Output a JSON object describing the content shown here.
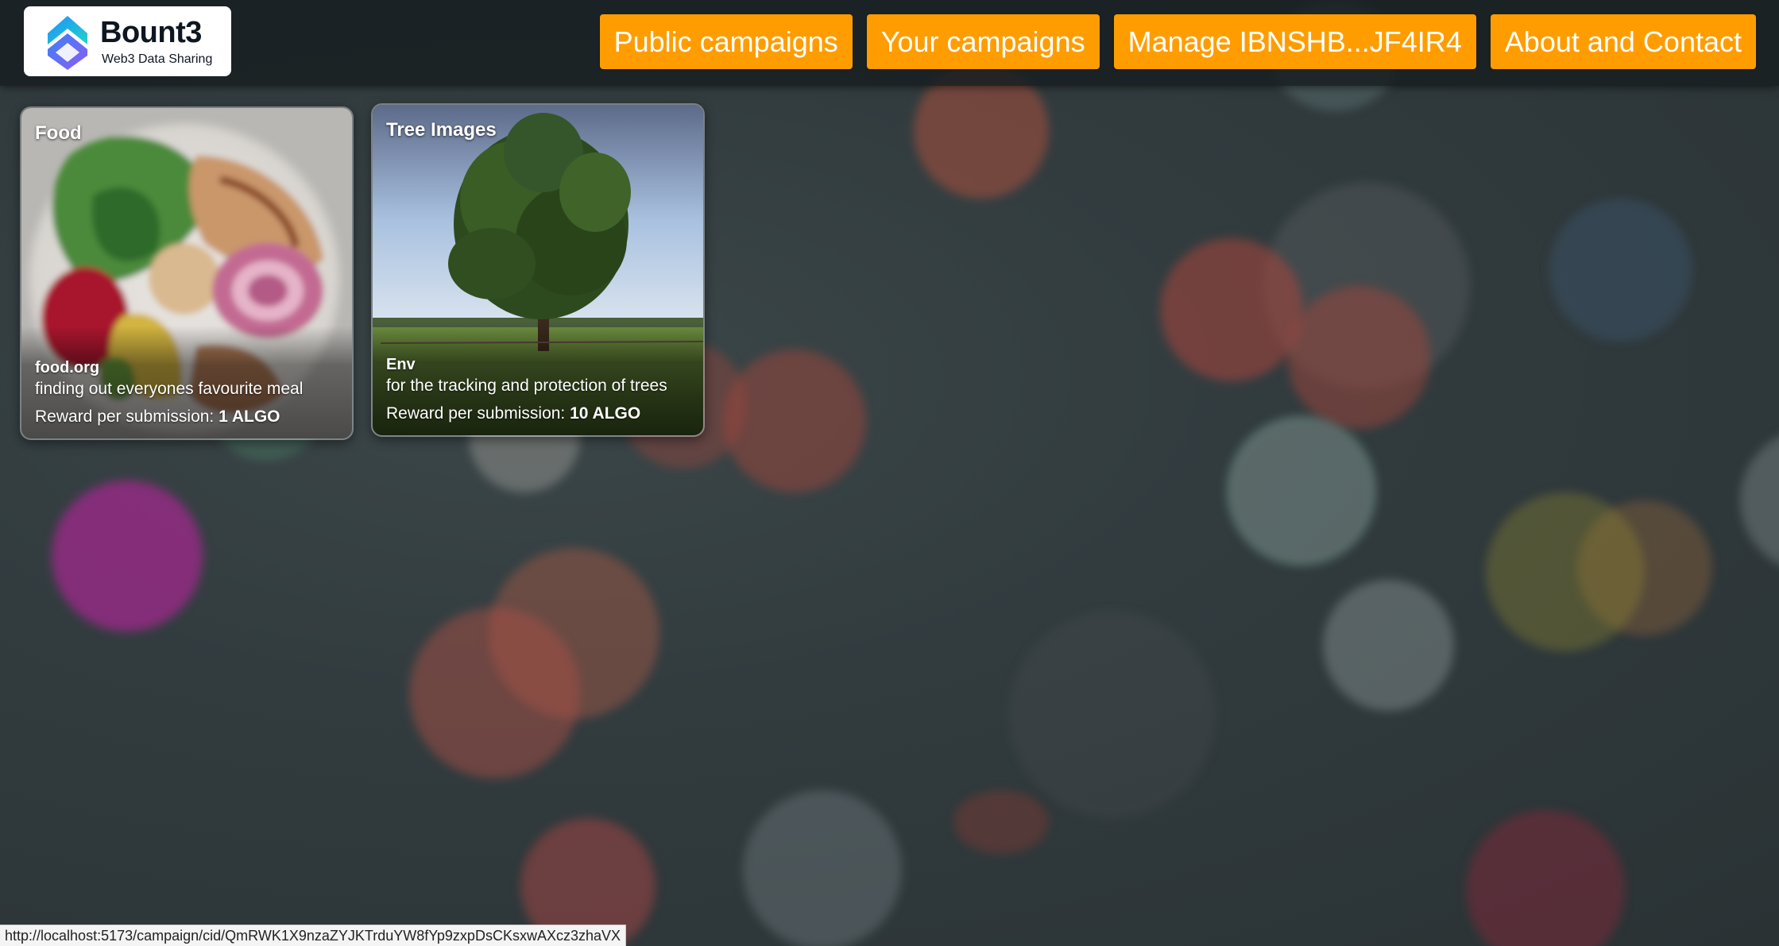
{
  "header": {
    "logo": {
      "name": "Bount3",
      "tagline": "Web3 Data Sharing"
    },
    "nav": [
      {
        "label": "Public campaigns"
      },
      {
        "label": "Your campaigns"
      },
      {
        "label": "Manage IBNSHB...JF4IR4"
      },
      {
        "label": "About and Contact"
      }
    ]
  },
  "campaigns": [
    {
      "title": "Food",
      "org": "food.org",
      "description": "finding out everyones favourite meal",
      "reward_label": "Reward per submission:",
      "reward_value": "1 ALGO"
    },
    {
      "title": "Tree Images",
      "org": "Env",
      "description": "for the tracking and protection of trees",
      "reward_label": "Reward per submission:",
      "reward_value": "10 ALGO"
    }
  ],
  "status_bar": {
    "url": "http://localhost:5173/campaign/cid/QmRWK1X9nzaZYJKTrduYW8fYp9zxpDsCKsxwAXcz3zhaVX"
  },
  "colors": {
    "nav_button": "#ff9d00",
    "header_bg": "#181e21",
    "background": "#2f3a3d"
  }
}
